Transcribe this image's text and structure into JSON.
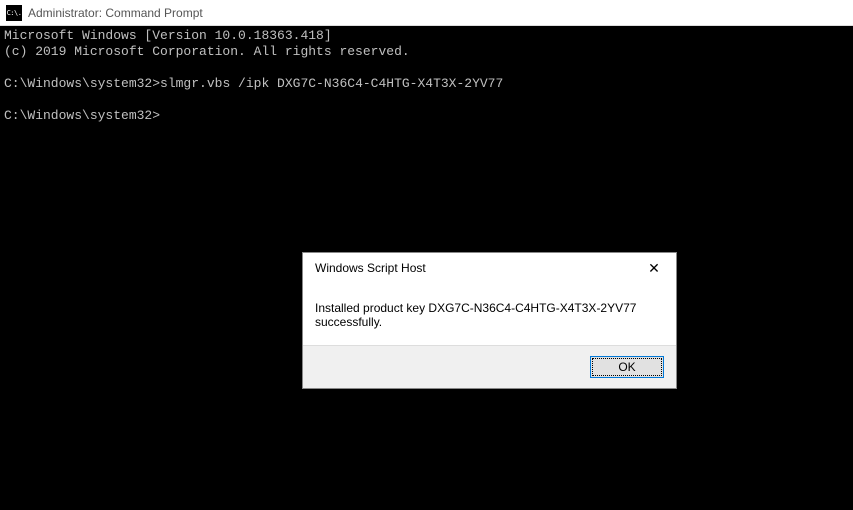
{
  "titlebar": {
    "icon_label": "C:\\.",
    "title": "Administrator: Command Prompt"
  },
  "terminal": {
    "line1": "Microsoft Windows [Version 10.0.18363.418]",
    "line2": "(c) 2019 Microsoft Corporation. All rights reserved.",
    "line3": "",
    "prompt1": "C:\\Windows\\system32>",
    "command1": "slmgr.vbs /ipk DXG7C-N36C4-C4HTG-X4T3X-2YV77",
    "line4": "",
    "prompt2": "C:\\Windows\\system32>"
  },
  "dialog": {
    "title": "Windows Script Host",
    "close_glyph": "✕",
    "message": "Installed product key DXG7C-N36C4-C4HTG-X4T3X-2YV77 successfully.",
    "ok_label": "OK"
  }
}
